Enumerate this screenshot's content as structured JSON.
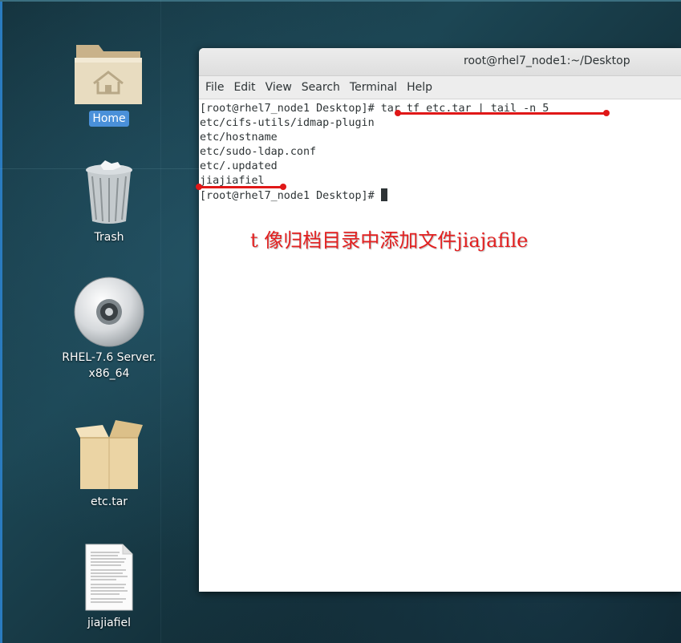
{
  "desktop": {
    "icons": [
      {
        "label": "Home",
        "icon": "home-folder-icon",
        "selected": true
      },
      {
        "label": "Trash",
        "icon": "trash-icon"
      },
      {
        "label": "RHEL-7.6 Server.",
        "label_line2": "x86_64",
        "icon": "disc-icon"
      },
      {
        "label": "etc.tar",
        "icon": "archive-icon"
      },
      {
        "label": "jiajiafiel",
        "icon": "text-document-icon"
      }
    ]
  },
  "terminal": {
    "title": "root@rhel7_node1:~/Desktop",
    "menu": [
      "File",
      "Edit",
      "View",
      "Search",
      "Terminal",
      "Help"
    ],
    "lines": [
      "[root@rhel7_node1 Desktop]# tar tf etc.tar | tail -n 5",
      "etc/cifs-utils/idmap-plugin",
      "etc/hostname",
      "etc/sudo-ldap.conf",
      "etc/.updated",
      "jiajiafiel"
    ],
    "prompt": "[root@rhel7_node1 Desktop]# "
  },
  "annotation": {
    "text": "t 像归档目录中添加文件jiajafile",
    "color": "#e32020"
  },
  "colors": {
    "selection": "#4a90d9",
    "annotation_red": "#e01818"
  }
}
